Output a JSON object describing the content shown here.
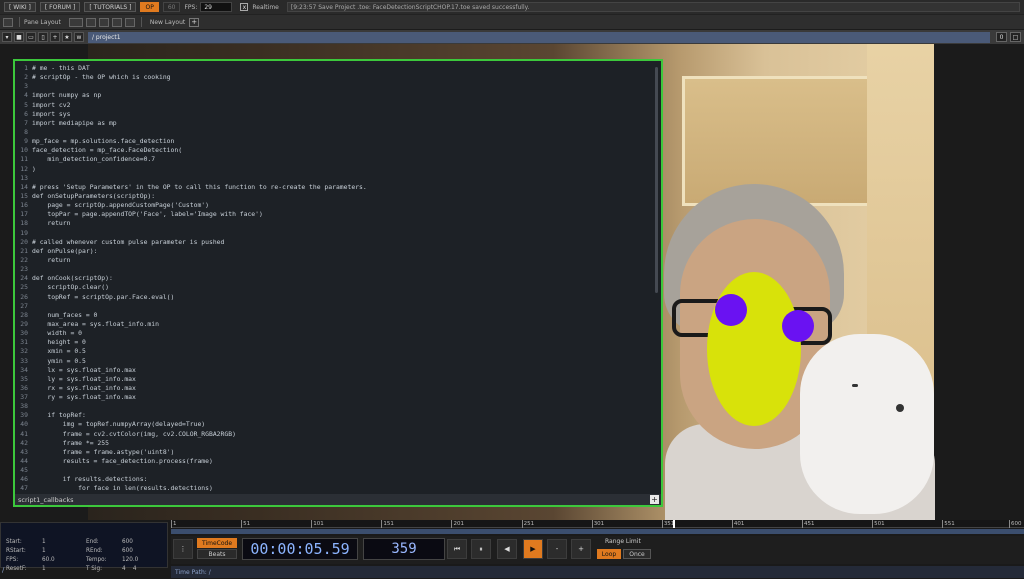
{
  "topbar": {
    "buttons": [
      "[ WIKI ]",
      "[ FORUM ]",
      "[ TUTORIALS ]"
    ],
    "op_button": "OP",
    "dim_button": "60",
    "fps_label": "FPS:",
    "fps_value": "29",
    "realtime_check": "x",
    "realtime_label": "Realtime",
    "status": "[9:23:57 Save Project .toe: FaceDetectionScriptCHOP.17.toe saved successfully."
  },
  "panebar": {
    "pane_layout": "Pane Layout",
    "new_layout": "New Layout",
    "plus": "+"
  },
  "pathbar": {
    "buttons": [
      "▾",
      "■",
      "▭",
      "▯",
      "+",
      "★",
      "w"
    ],
    "path": "/ project1",
    "right_buttons": [
      "0",
      "□"
    ]
  },
  "editor": {
    "footer": "script1_callbacks",
    "plus": "+",
    "lines": [
      "# me - this DAT",
      "# scriptOp - the OP which is cooking",
      "",
      "import numpy as np",
      "import cv2",
      "import sys",
      "import mediapipe as mp",
      "",
      "mp_face = mp.solutions.face_detection",
      "face_detection = mp_face.FaceDetection(",
      "    min_detection_confidence=0.7",
      ")",
      "",
      "# press 'Setup Parameters' in the OP to call this function to re-create the parameters.",
      "def onSetupParameters(scriptOp):",
      "    page = scriptOp.appendCustomPage('Custom')",
      "    topPar = page.appendTOP('Face', label='Image with face')",
      "    return",
      "",
      "# called whenever custom pulse parameter is pushed",
      "def onPulse(par):",
      "    return",
      "",
      "def onCook(scriptOp):",
      "    scriptOp.clear()",
      "    topRef = scriptOp.par.Face.eval()",
      "",
      "    num_faces = 0",
      "    max_area = sys.float_info.min",
      "    width = 0",
      "    height = 0",
      "    xmin = 0.5",
      "    ymin = 0.5",
      "    lx = sys.float_info.max",
      "    ly = sys.float_info.max",
      "    rx = sys.float_info.max",
      "    ry = sys.float_info.max",
      "",
      "    if topRef:",
      "        img = topRef.numpyArray(delayed=True)",
      "        frame = cv2.cvtColor(img, cv2.COLOR_RGBA2RGB)",
      "        frame *= 255",
      "        frame = frame.astype('uint8')",
      "        results = face_detection.process(frame)",
      "",
      "        if results.detections:",
      "            for face in len(results.detections)"
    ]
  },
  "ruler": {
    "ticks": [
      "1",
      "51",
      "101",
      "151",
      "201",
      "251",
      "301",
      "351",
      "401",
      "451",
      "501",
      "551",
      "600"
    ]
  },
  "info": {
    "start_label": "Start:",
    "start": "1",
    "rstart_label": "RStart:",
    "rstart": "1",
    "fps_label": "FPS:",
    "fps": "60.0",
    "resetf_label": "ResetF:",
    "resetf": "1",
    "end_label": "End:",
    "end": "600",
    "rend_label": "REnd:",
    "rend": "600",
    "tempo_label": "Tempo:",
    "tempo": "120.0",
    "tsig_label": "T Sig:",
    "tsig": "4    4"
  },
  "transport": {
    "timecode_btn": "TimeCode",
    "beats_btn": "Beats",
    "timecode": "00:00:05.59",
    "frame": "359",
    "rewind": "⏮",
    "pause": "⏸",
    "step_back": "◀",
    "play": "▶",
    "minus": "-",
    "plus": "+",
    "range_limit": "Range Limit",
    "loop": "Loop",
    "once": "Once"
  },
  "timepath": {
    "label": "Time Path: /"
  },
  "colors": {
    "accent": "#e07a1f",
    "editor_border": "#3cc83c",
    "mask_yellow": "#d8e20a",
    "eye_purple": "#6a12f2"
  }
}
